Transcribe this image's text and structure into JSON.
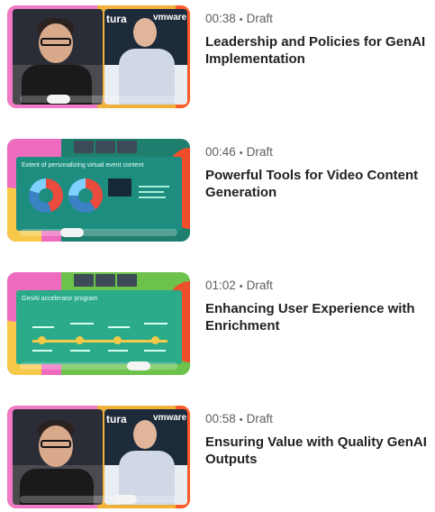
{
  "videos": [
    {
      "duration": "00:38",
      "separator": "•",
      "status": "Draft",
      "title": "Leadership and Policies for GenAI Implementation",
      "thumb_kind": "meeting",
      "wall_text_left": "tura",
      "wall_text_right": "vmware",
      "progress": 0.2
    },
    {
      "duration": "00:46",
      "separator": "•",
      "status": "Draft",
      "title": "Powerful Tools for Video Content Generation",
      "thumb_kind": "slide-donut",
      "slide_heading": "Extent of personalizing virtual event content",
      "progress": 0.3
    },
    {
      "duration": "01:02",
      "separator": "•",
      "status": "Draft",
      "title": "Enhancing User Experience with Enrichment",
      "thumb_kind": "slide-timeline",
      "slide_heading": "GenAI accelerator program",
      "progress": 0.8
    },
    {
      "duration": "00:58",
      "separator": "•",
      "status": "Draft",
      "title": "Ensuring Value with Quality GenAI Outputs",
      "thumb_kind": "meeting",
      "wall_text_left": "tura",
      "wall_text_right": "vmware",
      "progress": 0.7
    }
  ],
  "colors": {
    "title": "#222222",
    "meta": "#5f5f5f"
  },
  "icons": {
    "separator": "bullet-dot"
  }
}
